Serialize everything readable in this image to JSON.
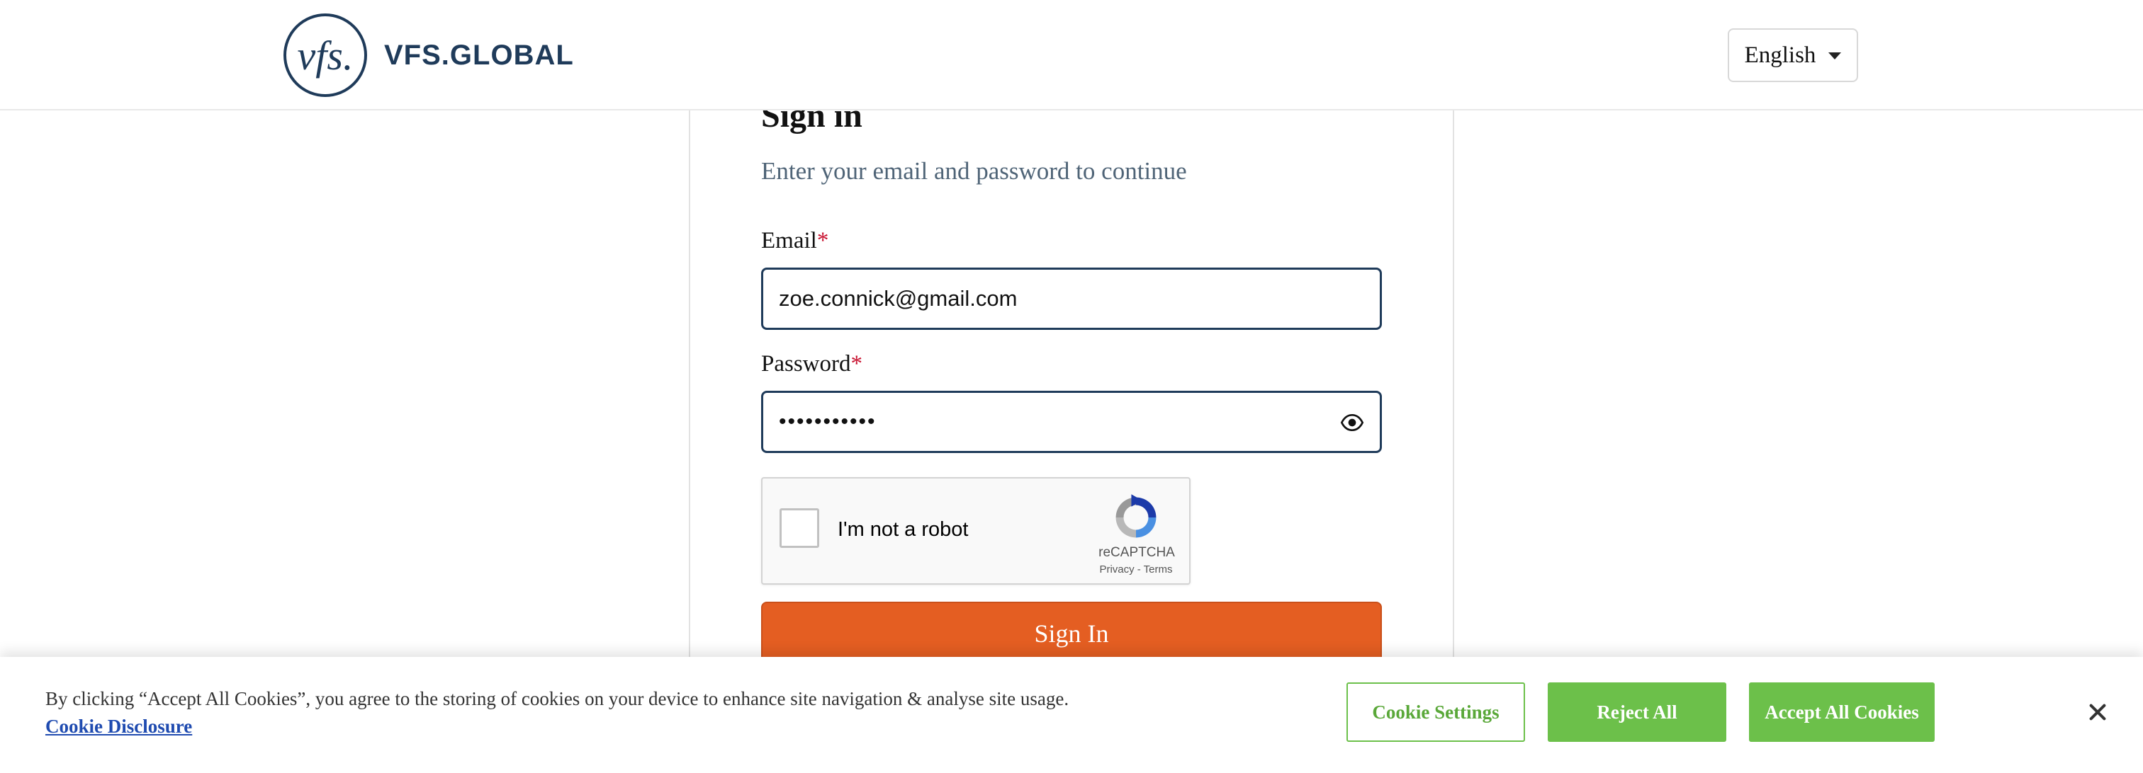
{
  "header": {
    "logo_mark": "vfs.",
    "logo_text": "VFS.GLOBAL",
    "language": "English"
  },
  "signin": {
    "title": "Sign in",
    "subtitle": "Enter your email and password to continue",
    "email_label": "Email",
    "password_label": "Password",
    "required_marker": "*",
    "email_value": "zoe.connick@gmail.com",
    "password_value": "•••••••••••",
    "button_label": "Sign In"
  },
  "captcha": {
    "label": "I'm not a robot",
    "brand": "reCAPTCHA",
    "links": "Privacy - Terms",
    "checked": false
  },
  "cookie_banner": {
    "text": "By clicking “Accept All Cookies”, you agree to the storing of cookies on your device to enhance site navigation & analyse site usage.",
    "link_label": "Cookie Disclosure",
    "settings_label": "Cookie Settings",
    "reject_label": "Reject All",
    "accept_label": "Accept All Cookies"
  },
  "colors": {
    "brand_navy": "#1f3b5a",
    "primary_orange": "#e45e22",
    "cookie_green": "#6cc04a",
    "required_red": "#c8102e"
  }
}
